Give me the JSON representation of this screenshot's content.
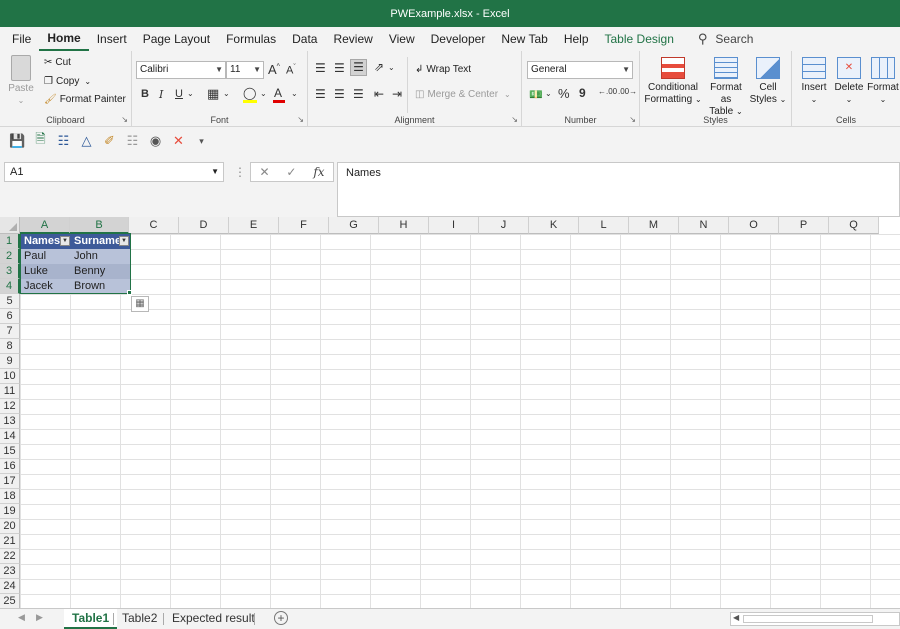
{
  "window": {
    "title": "PWExample.xlsx  -  Excel"
  },
  "menu": {
    "tabs": [
      "File",
      "Home",
      "Insert",
      "Page Layout",
      "Formulas",
      "Data",
      "Review",
      "View",
      "Developer",
      "New Tab",
      "Help",
      "Table Design"
    ],
    "active": "Home",
    "search_label": "Search"
  },
  "ribbon": {
    "clipboard": {
      "label": "Clipboard",
      "paste": "Paste",
      "cut": "Cut",
      "copy": "Copy",
      "format_painter": "Format Painter"
    },
    "font": {
      "label": "Font",
      "family": "Calibri",
      "size": "11",
      "bold": "B",
      "italic": "I",
      "underline": "U",
      "grow": "A",
      "shrink": "A"
    },
    "alignment": {
      "label": "Alignment",
      "wrap_text": "Wrap Text",
      "merge_center": "Merge & Center"
    },
    "number": {
      "label": "Number",
      "format": "General",
      "percent": "%",
      "comma": "9",
      "inc_decimal": ".00",
      "dec_decimal": ".00"
    },
    "styles": {
      "label": "Styles",
      "conditional_1": "Conditional",
      "conditional_2": "Formatting",
      "format_table_1": "Format as",
      "format_table_2": "Table",
      "cell_styles_1": "Cell",
      "cell_styles_2": "Styles"
    },
    "cells": {
      "label": "Cells",
      "insert": "Insert",
      "delete": "Delete",
      "format": "Format"
    }
  },
  "formula_bar": {
    "name_box": "A1",
    "content": "Names",
    "fx": "fx",
    "cancel": "✕",
    "enter": "✓"
  },
  "grid": {
    "columns": [
      "A",
      "B",
      "C",
      "D",
      "E",
      "F",
      "G",
      "H",
      "I",
      "J",
      "K",
      "L",
      "M",
      "N",
      "O",
      "P",
      "Q"
    ],
    "rows": [
      "1",
      "2",
      "3",
      "4",
      "5",
      "6",
      "7",
      "8",
      "9",
      "10",
      "11",
      "12",
      "13",
      "14",
      "15",
      "16",
      "17",
      "18",
      "19",
      "20",
      "21",
      "22",
      "23",
      "24",
      "25"
    ],
    "table": {
      "headers": [
        "Names",
        "Surname"
      ],
      "rows": [
        [
          "Paul",
          "John"
        ],
        [
          "Luke",
          "Benny"
        ],
        [
          "Jacek",
          "Brown"
        ]
      ]
    }
  },
  "sheets": {
    "tabs": [
      "Table1",
      "Table2",
      "Expected result"
    ],
    "active": "Table1"
  },
  "colors": {
    "accent": "#217346",
    "table_header": "#3d5a99",
    "table_band": "#b8c2d9"
  }
}
